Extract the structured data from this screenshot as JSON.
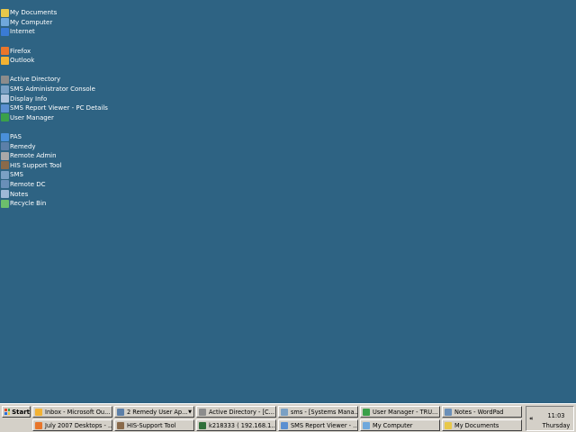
{
  "desktop": {
    "background": "#2e6383",
    "icons": [
      {
        "label": "My Documents",
        "icon": "my-documents-icon",
        "color": "#e8c84a"
      },
      {
        "label": "My Computer",
        "icon": "my-computer-icon",
        "color": "#6fa8dc"
      },
      {
        "label": "Internet",
        "icon": "internet-explorer-icon",
        "color": "#3a7bd5"
      },
      {
        "gap": true
      },
      {
        "label": "Firefox",
        "icon": "firefox-icon",
        "color": "#e8762b"
      },
      {
        "label": "Outlook",
        "icon": "outlook-icon",
        "color": "#f2b233"
      },
      {
        "gap": true
      },
      {
        "label": "Active Directory",
        "icon": "active-directory-icon",
        "color": "#8c8c8c"
      },
      {
        "label": "SMS Administrator Console",
        "icon": "sms-console-icon",
        "color": "#7aa0c4"
      },
      {
        "label": "Display Info",
        "icon": "display-info-icon",
        "color": "#b0c4de"
      },
      {
        "label": "SMS Report Viewer - PC Details",
        "icon": "report-viewer-icon",
        "color": "#5b8fd1"
      },
      {
        "label": "User Manager",
        "icon": "user-manager-icon",
        "color": "#3aa04a"
      },
      {
        "gap": true
      },
      {
        "label": "PAS",
        "icon": "pas-icon",
        "color": "#4a90d9"
      },
      {
        "label": "Remedy",
        "icon": "remedy-icon",
        "color": "#5c7fa8"
      },
      {
        "label": "Remote Admin",
        "icon": "remote-admin-icon",
        "color": "#a8a8a8"
      },
      {
        "label": "HIS Support Tool",
        "icon": "support-tool-icon",
        "color": "#8a6a4a"
      },
      {
        "label": "SMS",
        "icon": "sms-icon",
        "color": "#7aa0c4"
      },
      {
        "label": "Remote DC",
        "icon": "remote-dc-icon",
        "color": "#6a8fb8"
      },
      {
        "label": "Notes",
        "icon": "notes-icon",
        "color": "#9fb8d8"
      },
      {
        "label": "Recycle Bin",
        "icon": "recycle-bin-icon",
        "color": "#6cbf6c"
      }
    ]
  },
  "taskbar": {
    "start_label": "Start",
    "row1": [
      {
        "label": "Inbox - Microsoft Ou...",
        "icon": "outlook-icon",
        "color": "#f2b233"
      },
      {
        "label": "2 Remedy User Ap...",
        "icon": "remedy-icon",
        "color": "#5c7fa8",
        "group": true
      },
      {
        "label": "Active Directory - [C...",
        "icon": "active-directory-icon",
        "color": "#8c8c8c"
      },
      {
        "label": "sms - [Systems Mana...",
        "icon": "sms-console-icon",
        "color": "#7aa0c4"
      },
      {
        "label": "User Manager - TRU...",
        "icon": "user-manager-icon",
        "color": "#3aa04a"
      },
      {
        "label": "Notes - WordPad",
        "icon": "wordpad-icon",
        "color": "#6a8fb8"
      }
    ],
    "row2": [
      {
        "label": "July 2007 Desktops - ...",
        "icon": "firefox-icon",
        "color": "#e8762b"
      },
      {
        "label": "HIS-Support Tool",
        "icon": "support-tool-icon",
        "color": "#8a6a4a"
      },
      {
        "label": "k218333 ( 192.168.1....",
        "icon": "remote-desktop-icon",
        "color": "#2f6f3a"
      },
      {
        "label": "SMS Report Viewer - ...",
        "icon": "report-viewer-icon",
        "color": "#5b8fd1"
      },
      {
        "label": "My Computer",
        "icon": "my-computer-icon",
        "color": "#6fa8dc"
      },
      {
        "label": "My Documents",
        "icon": "my-documents-icon",
        "color": "#e8c84a"
      }
    ],
    "tray": {
      "expand_glyph": "«",
      "time": "11:03",
      "day": "Thursday"
    }
  }
}
